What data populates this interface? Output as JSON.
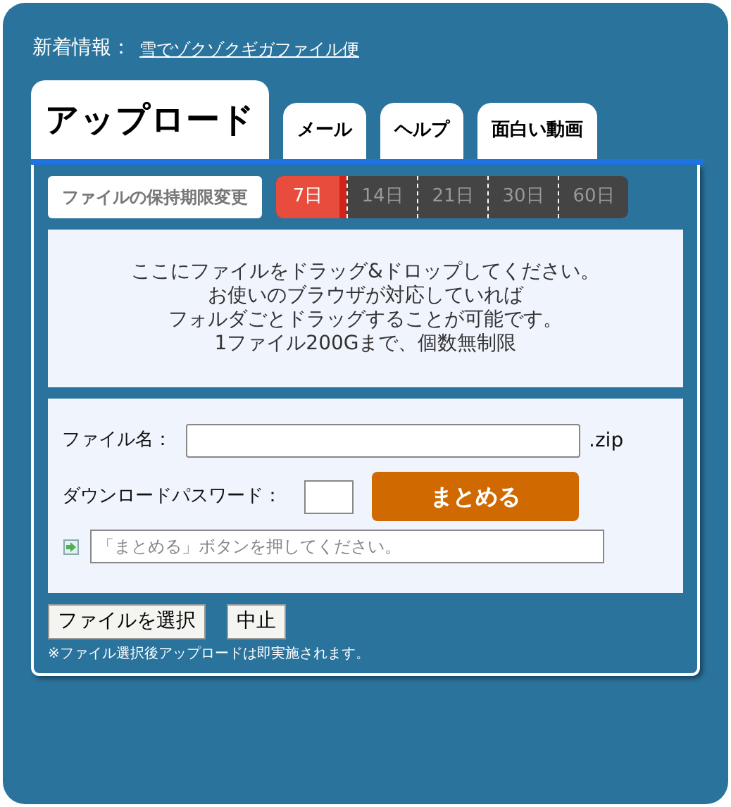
{
  "news": {
    "label": "新着情報：",
    "link": "雪でゾクゾクギガファイル便"
  },
  "tabs": [
    {
      "label": "アップロード",
      "selected": true
    },
    {
      "label": "メール",
      "selected": false
    },
    {
      "label": "ヘルプ",
      "selected": false
    },
    {
      "label": "面白い動画",
      "selected": false
    }
  ],
  "retention": {
    "label": "ファイルの保持期限変更",
    "options": [
      {
        "label": "7日",
        "selected": true
      },
      {
        "label": "14日",
        "selected": false
      },
      {
        "label": "21日",
        "selected": false
      },
      {
        "label": "30日",
        "selected": false
      },
      {
        "label": "60日",
        "selected": false
      }
    ]
  },
  "drop_zone": {
    "lines": [
      "ここにファイルをドラッグ&ドロップしてください。",
      "お使いのブラウザが対応していれば",
      "フォルダごとドラッグすることが可能です。",
      "1ファイル200Gまで、個数無制限"
    ]
  },
  "form": {
    "filename_label": "ファイル名：",
    "extension": ".zip",
    "password_label": "ダウンロードパスワード：",
    "submit": "まとめる",
    "message_placeholder": "「まとめる」ボタンを押してください。"
  },
  "buttons": [
    "ファイルを選択",
    "中止"
  ],
  "note": "※ファイル選択後アップロードは即実施されます。"
}
